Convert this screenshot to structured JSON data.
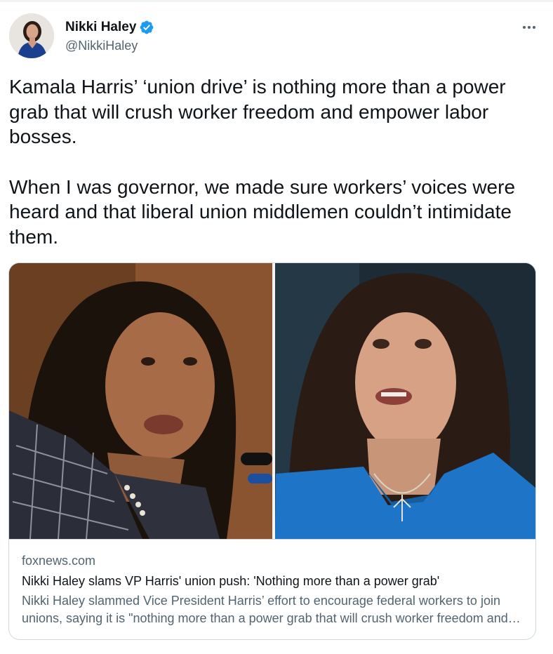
{
  "author": {
    "display_name": "Nikki Haley",
    "handle": "@NikkiHaley",
    "verified": true,
    "verified_color": "#1d9bf0"
  },
  "tweet": {
    "paragraph_1": "Kamala Harris’ ‘union drive’ is nothing more than a power grab that will crush worker freedom and empower labor bosses.",
    "paragraph_2": "When I was governor, we made sure workers’ voices were heard and that liberal union middlemen couldn’t intimidate them."
  },
  "link_card": {
    "domain": "foxnews.com",
    "title": "Nikki Haley slams VP Harris' union push: 'Nothing more than a power grab'",
    "description": "Nikki Haley slammed Vice President Harris’ effort to encourage federal workers to join unions, saying it is \"nothing more than a power grab that will crush worker freedom and empower labor bosses\"",
    "image_left": "photo-kamala-harris",
    "image_right": "photo-nikki-haley"
  },
  "colors": {
    "text_primary": "#0f1419",
    "text_secondary": "#536471",
    "border": "#cfd9de",
    "accent": "#1d9bf0"
  },
  "icons": {
    "verified": "verified-badge-icon",
    "more": "more-horizontal-icon"
  }
}
